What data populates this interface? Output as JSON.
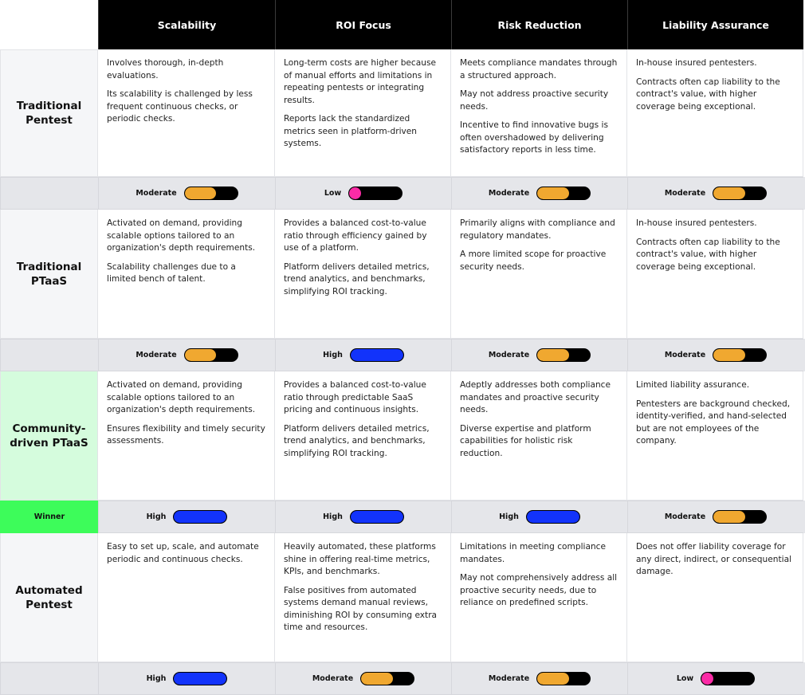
{
  "colors": {
    "low": "#fb2ba6",
    "moderate": "#f0a830",
    "high": "#1233fb",
    "winner_badge": "#3dfc5a",
    "winner_row_label": "#d5fcdd",
    "header_bg": "#000000"
  },
  "levels": {
    "Low": 0.22,
    "Moderate": 0.6,
    "High": 1.0
  },
  "columns": [
    "Scalability",
    "ROI Focus",
    "Risk Reduction",
    "Liability Assurance"
  ],
  "rows": [
    {
      "label": "Traditional Pentest",
      "winner": false,
      "badge": "",
      "cells": [
        [
          "Involves thorough, in-depth evaluations.",
          "Its scalability is challenged by less frequent continuous checks, or periodic checks."
        ],
        [
          "Long-term costs are higher because of manual efforts and limitations in repeating pentests or integrating results.",
          "Reports lack the standardized metrics seen in platform-driven systems."
        ],
        [
          "Meets compliance mandates through a structured approach.",
          "May not address proactive security needs.",
          "Incentive to find innovative bugs is often overshadowed by delivering satisfactory reports in less time."
        ],
        [
          "In-house insured pentesters.",
          "Contracts often cap liability to the contract's value, with higher coverage being exceptional."
        ]
      ],
      "ratings": [
        "Moderate",
        "Low",
        "Moderate",
        "Moderate"
      ]
    },
    {
      "label": "Traditional PTaaS",
      "winner": false,
      "badge": "",
      "cells": [
        [
          "Activated on demand, providing scalable options tailored to an organization's depth requirements.",
          "Scalability challenges due to a limited bench of talent."
        ],
        [
          "Provides a balanced cost-to-value ratio through efficiency gained by use of a platform.",
          "Platform delivers detailed metrics, trend analytics, and benchmarks, simplifying ROI tracking."
        ],
        [
          "Primarily aligns with compliance and regulatory mandates.",
          "A more limited scope for proactive security needs."
        ],
        [
          "In-house insured pentesters.",
          "Contracts often cap liability to the contract's value, with higher coverage being exceptional."
        ]
      ],
      "ratings": [
        "Moderate",
        "High",
        "Moderate",
        "Moderate"
      ]
    },
    {
      "label": "Community-driven PTaaS",
      "winner": true,
      "badge": "Winner",
      "cells": [
        [
          "Activated on demand, providing scalable options tailored to an organization's depth requirements.",
          "Ensures flexibility and timely security assessments."
        ],
        [
          "Provides a balanced cost-to-value ratio through predictable SaaS pricing and continuous insights.",
          "Platform delivers detailed metrics, trend analytics, and benchmarks, simplifying ROI tracking."
        ],
        [
          "Adeptly addresses both compliance mandates and proactive security needs.",
          "Diverse expertise and platform capabilities for holistic risk reduction."
        ],
        [
          "Limited liability assurance.",
          "Pentesters are background checked, identity-verified, and hand-selected but are not employees of the company."
        ]
      ],
      "ratings": [
        "High",
        "High",
        "High",
        "Moderate"
      ]
    },
    {
      "label": "Automated Pentest",
      "winner": false,
      "badge": "",
      "cells": [
        [
          "Easy to set up, scale, and automate periodic and continuous checks."
        ],
        [
          "Heavily automated, these platforms shine in offering real-time metrics, KPIs, and benchmarks.",
          "False positives from automated systems demand manual reviews, diminishing ROI by consuming extra time and resources."
        ],
        [
          "Limitations in meeting compliance mandates.",
          "May not comprehensively address all proactive security needs, due to reliance on predefined scripts."
        ],
        [
          "Does not offer liability coverage for any direct, indirect, or consequential damage."
        ]
      ],
      "ratings": [
        "High",
        "Moderate",
        "Moderate",
        "Low"
      ]
    }
  ]
}
